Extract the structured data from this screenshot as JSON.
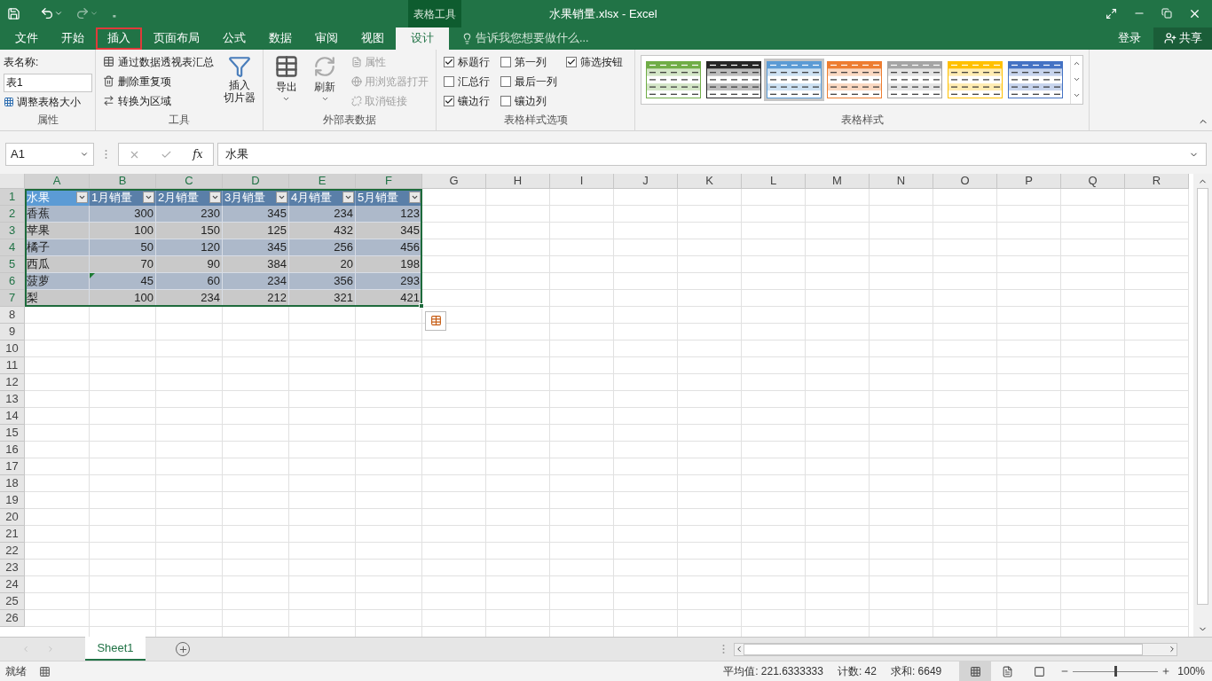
{
  "quick_access": {
    "customize": "₌"
  },
  "contextual_tab_group": "表格工具",
  "window": {
    "title": "水果销量.xlsx - Excel"
  },
  "tabs": [
    {
      "label": "文件",
      "selected": false,
      "highlighted": false
    },
    {
      "label": "开始",
      "selected": false,
      "highlighted": false
    },
    {
      "label": "插入",
      "selected": false,
      "highlighted": true
    },
    {
      "label": "页面布局",
      "selected": false,
      "highlighted": false
    },
    {
      "label": "公式",
      "selected": false,
      "highlighted": false
    },
    {
      "label": "数据",
      "selected": false,
      "highlighted": false
    },
    {
      "label": "审阅",
      "selected": false,
      "highlighted": false
    },
    {
      "label": "视图",
      "selected": false,
      "highlighted": false
    },
    {
      "label": "设计",
      "selected": true,
      "highlighted": false
    }
  ],
  "tell_me": {
    "placeholder": "告诉我您想要做什么..."
  },
  "account": {
    "sign_in": "登录",
    "share": "共享"
  },
  "ribbon": {
    "properties": {
      "label": "表名称:",
      "table_name": "表1",
      "resize": "调整表格大小",
      "group": "属性"
    },
    "tools": {
      "items": [
        {
          "label": "通过数据透视表汇总"
        },
        {
          "label": "删除重复项"
        },
        {
          "label": "转换为区域"
        }
      ],
      "slicer": [
        "插入",
        "切片器"
      ],
      "group": "工具"
    },
    "external": {
      "export": "导出",
      "refresh": "刷新",
      "items": [
        {
          "label": "属性",
          "disabled": true
        },
        {
          "label": "用浏览器打开",
          "disabled": true
        },
        {
          "label": "取消链接",
          "disabled": true
        }
      ],
      "group": "外部表数据"
    },
    "style_options": {
      "options": [
        {
          "label": "标题行",
          "checked": true
        },
        {
          "label": "汇总行",
          "checked": false
        },
        {
          "label": "镶边行",
          "checked": true
        },
        {
          "label": "第一列",
          "checked": false
        },
        {
          "label": "最后一列",
          "checked": false
        },
        {
          "label": "镶边列",
          "checked": false
        },
        {
          "label": "筛选按钮",
          "checked": true
        }
      ],
      "group": "表格样式选项"
    },
    "styles": {
      "items": [
        {
          "color": "#70ad47",
          "selected": false
        },
        {
          "color": "#262626",
          "selected": false
        },
        {
          "color": "#5b9bd5",
          "selected": true
        },
        {
          "color": "#ed7d31",
          "selected": false
        },
        {
          "color": "#a5a5a5",
          "selected": false
        },
        {
          "color": "#ffc000",
          "selected": false
        },
        {
          "color": "#4472c4",
          "selected": false
        }
      ],
      "group": "表格样式"
    }
  },
  "formula_bar": {
    "name_box": "A1",
    "fx": "fx",
    "value": "水果"
  },
  "columns": [
    "A",
    "B",
    "C",
    "D",
    "E",
    "F",
    "G",
    "H",
    "I",
    "J",
    "K",
    "L",
    "M",
    "N",
    "O",
    "P",
    "Q",
    "R"
  ],
  "row_numbers": [
    "1",
    "2",
    "3",
    "4",
    "5",
    "6",
    "7",
    "8",
    "9",
    "10",
    "11",
    "12",
    "13",
    "14",
    "15",
    "16",
    "17",
    "18",
    "19",
    "20",
    "21",
    "22",
    "23",
    "24",
    "25",
    "26"
  ],
  "table": {
    "header": [
      {
        "text": "水果",
        "active": true
      },
      {
        "text": "1月销量",
        "active": false
      },
      {
        "text": "2月销量",
        "active": false
      },
      {
        "text": "3月销量",
        "active": false
      },
      {
        "text": "4月销量",
        "active": false
      },
      {
        "text": "5月销量",
        "active": false
      }
    ],
    "rows": [
      [
        "香蕉",
        "300",
        "230",
        "345",
        "234",
        "123"
      ],
      [
        "苹果",
        "100",
        "150",
        "125",
        "432",
        "345"
      ],
      [
        "橘子",
        "50",
        "120",
        "345",
        "256",
        "456"
      ],
      [
        "西瓜",
        "70",
        "90",
        "384",
        "20",
        "198"
      ],
      [
        "菠萝",
        "45",
        "60",
        "234",
        "356",
        "293"
      ],
      [
        "梨",
        "100",
        "234",
        "212",
        "321",
        "421"
      ]
    ]
  },
  "sheets": [
    {
      "name": "Sheet1",
      "selected": true
    }
  ],
  "status_bar": {
    "ready": "就绪",
    "average": "平均值: 221.6333333",
    "count": "计数: 42",
    "sum": "求和: 6649",
    "views": [
      {
        "kind": "normal",
        "selected": true
      },
      {
        "kind": "layout",
        "selected": false
      },
      {
        "kind": "pagebreak",
        "selected": false
      }
    ],
    "zoom_slider": {
      "level": 0.5
    },
    "zoom": "100%"
  }
}
